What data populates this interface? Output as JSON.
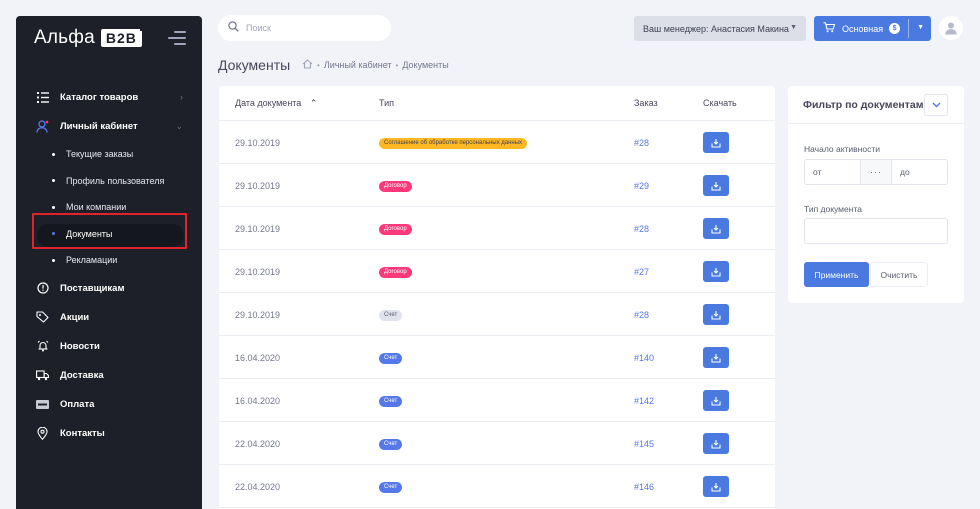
{
  "brand": {
    "name": "Альфа",
    "suffix": "B2B"
  },
  "sidebar": {
    "items": [
      {
        "label": "Каталог товаров",
        "icon": "list-icon",
        "arrow": "›"
      },
      {
        "label": "Личный кабинет",
        "icon": "user-icon",
        "arrow": "‹"
      }
    ],
    "submenu": [
      {
        "label": "Текущие заказы"
      },
      {
        "label": "Профиль пользователя"
      },
      {
        "label": "Мои компании"
      },
      {
        "label": "Документы",
        "active": true
      },
      {
        "label": "Рекламации"
      }
    ],
    "items_after": [
      {
        "label": "Поставщикам",
        "icon": "info-icon"
      },
      {
        "label": "Акции",
        "icon": "tag-icon"
      },
      {
        "label": "Новости",
        "icon": "bell-icon"
      },
      {
        "label": "Доставка",
        "icon": "truck-icon"
      },
      {
        "label": "Оплата",
        "icon": "visa-card-icon"
      },
      {
        "label": "Контакты",
        "icon": "location-pin-icon"
      }
    ]
  },
  "search": {
    "placeholder": "Поиск"
  },
  "header": {
    "manager_label": "Ваш менеджер: Анастасия Макина",
    "cart_label": "Основная",
    "cart_badge": "$"
  },
  "page": {
    "title": "Документы",
    "breadcrumb": [
      "Личный кабинет",
      "Документы"
    ]
  },
  "table": {
    "columns": {
      "date": "Дата документа",
      "sort_indicator": "⌃",
      "type": "Тип",
      "order": "Заказ",
      "download": "Скачать"
    },
    "rows": [
      {
        "date": "29.10.2019",
        "type": "Соглашение об обработке персональных данных",
        "type_style": "agreement",
        "order": "#28"
      },
      {
        "date": "29.10.2019",
        "type": "Договор",
        "type_style": "contract",
        "order": "#29"
      },
      {
        "date": "29.10.2019",
        "type": "Договор",
        "type_style": "contract",
        "order": "#28"
      },
      {
        "date": "29.10.2019",
        "type": "Договор",
        "type_style": "contract",
        "order": "#27"
      },
      {
        "date": "29.10.2019",
        "type": "Счет",
        "type_style": "invoice-gray",
        "order": "#28"
      },
      {
        "date": "16.04.2020",
        "type": "Счет",
        "type_style": "invoice-blue",
        "order": "#140"
      },
      {
        "date": "16.04.2020",
        "type": "Счет",
        "type_style": "invoice-blue",
        "order": "#142"
      },
      {
        "date": "22.04.2020",
        "type": "Счет",
        "type_style": "invoice-blue",
        "order": "#145"
      },
      {
        "date": "22.04.2020",
        "type": "Счет",
        "type_style": "invoice-blue",
        "order": "#146"
      }
    ]
  },
  "filter": {
    "title": "Фильтр по документам",
    "activity_label": "Начало активности",
    "from_placeholder": "от",
    "range_separator": "···",
    "to_placeholder": "до",
    "type_label": "Тип документа",
    "type_value": "",
    "apply_label": "Применить",
    "clear_label": "Очистить"
  },
  "colors": {
    "sidebar_bg": "#1e2029",
    "primary": "#4a7ae0",
    "warning": "#ffb822",
    "danger": "#fd397a",
    "highlight": "#e0242b"
  }
}
